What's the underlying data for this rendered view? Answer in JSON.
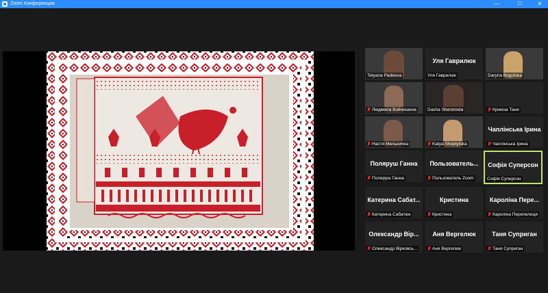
{
  "window": {
    "title": "Zoom Конференция",
    "minimize_glyph": "—",
    "maximize_glyph": "☐",
    "close_glyph": "✕"
  },
  "share": {
    "kind": "screen-share",
    "content": "embroidered towel picture"
  },
  "participants": [
    {
      "name": "Tetyana Padeeva",
      "display": "",
      "muted": false,
      "video": true
    },
    {
      "name": "Уля Гаврилюк",
      "display": "Уля Гаврилюк",
      "muted": false,
      "video": false
    },
    {
      "name": "Daryna Bogotska",
      "display": "",
      "muted": false,
      "video": true
    },
    {
      "name": "Людмила Войчишина",
      "display": "",
      "muted": true,
      "video": true
    },
    {
      "name": "Dasha Sheremeta",
      "display": "",
      "muted": false,
      "video": true
    },
    {
      "name": "Крикіна Таня",
      "display": "",
      "muted": true,
      "video": true
    },
    {
      "name": "Настя Мельничка",
      "display": "",
      "muted": true,
      "video": true
    },
    {
      "name": "Katya Sheptytska",
      "display": "",
      "muted": true,
      "video": true
    },
    {
      "name": "Чаплінська Ірина",
      "display": "Чаплінська Ірина",
      "muted": true,
      "video": false
    },
    {
      "name": "Поляруш Ганна",
      "display": "Поляруш Ганна",
      "muted": true,
      "video": false
    },
    {
      "name": "Пользователь Zoom",
      "display": "Пользователь...",
      "muted": true,
      "video": false
    },
    {
      "name": "Софія Суперсон",
      "display": "Софія Суперсон",
      "muted": false,
      "video": false,
      "speaking": true
    },
    {
      "name": "Катерина Сабатюк",
      "display": "Катерина Сабат...",
      "muted": true,
      "video": false
    },
    {
      "name": "Кристина",
      "display": "Кристина",
      "muted": true,
      "video": false
    },
    {
      "name": "Кароліна Перепелиця",
      "display": "Кароліна Пере...",
      "muted": true,
      "video": false
    },
    {
      "name": "Олександр Вірковсь...",
      "display": "Олександр Вір...",
      "muted": true,
      "video": false
    },
    {
      "name": "Аня Вергелюк",
      "display": "Аня Вергелюк",
      "muted": true,
      "video": false
    },
    {
      "name": "Таня Суприган",
      "display": "Таня Суприган",
      "muted": true,
      "video": false
    }
  ],
  "colors": {
    "titlebar": "#2d8cff",
    "background": "#1a1a1a",
    "tile": "#232323",
    "speaking_border": "#c6e370",
    "mic_muted": "#e02828",
    "embroidery_red": "#c8202a",
    "embroidery_black": "#1a1a1a",
    "linen": "#ede8e1"
  }
}
